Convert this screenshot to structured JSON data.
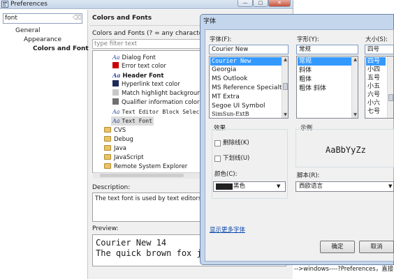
{
  "preferences": {
    "title": "Preferences",
    "filter_value": "font",
    "tree": [
      "General",
      "Appearance",
      "Colors and Fonts"
    ],
    "section_title": "Colors and Fonts",
    "colors_desc": "Colors and Fonts (? = any character, * =",
    "type_filter_placeholder": "type filter text",
    "items": [
      {
        "label": "Dialog Font",
        "icon": "font-aa-icon"
      },
      {
        "label": "Error text color",
        "icon": "red-square-icon"
      },
      {
        "label": "Header Font",
        "icon": "font-aa-icon"
      },
      {
        "label": "Hyperlink text color",
        "icon": "navy-square-icon"
      },
      {
        "label": "Match highlight background",
        "icon": "grey-square-icon"
      },
      {
        "label": "Qualifier information color",
        "icon": "darkgrey-square-icon"
      },
      {
        "label": "Text Editor Block Select",
        "icon": "font-aa-icon"
      },
      {
        "label": "Text Font",
        "icon": "font-aa-icon"
      },
      {
        "label": "CVS",
        "icon": "folder-icon"
      },
      {
        "label": "Debug",
        "icon": "folder-icon"
      },
      {
        "label": "Java",
        "icon": "folder-icon"
      },
      {
        "label": "JavaScript",
        "icon": "folder-icon"
      },
      {
        "label": "Remote System Explorer",
        "icon": "folder-icon"
      }
    ],
    "description_label": "Description:",
    "description_text": "The text font is used by text editors.",
    "preview_label": "Preview:",
    "preview_lines": [
      "Courier New 14",
      "The quick brown fox j"
    ],
    "colors": {
      "error": "#cc0000",
      "hyperlink": "#1f2a5a",
      "highlight": "#c8c8c8",
      "qualifier": "#707070"
    }
  },
  "font_dialog": {
    "title": "字体",
    "font_label": "字体(F):",
    "font_value": "Courier New",
    "font_list": [
      "Courier New",
      "Georgia",
      "MS Outlook",
      "MS Reference Specialt",
      "MT Extra",
      "Segoe UI Symbol",
      "SimSun-ExtB"
    ],
    "style_label": "字形(Y):",
    "style_value": "常规",
    "style_list": [
      "常规",
      "斜体",
      "粗体",
      "粗体 斜体"
    ],
    "size_label": "大小(S):",
    "size_value": "四号",
    "size_list": [
      "四号",
      "小四",
      "五号",
      "小五",
      "六号",
      "小六",
      "七号"
    ],
    "effects_label": "效果",
    "strikeout_label": "删除线(K)",
    "underline_label": "下划线(U)",
    "color_label": "颜色(C):",
    "color_value": "黑色",
    "sample_label": "示例",
    "sample_text": "AaBbYyZz",
    "script_label": "脚本(R):",
    "script_value": "西欧语言",
    "more_fonts": "显示更多字体",
    "ok": "确定",
    "cancel": "取消"
  },
  "background_text": "-->windows----?Preferences，直接"
}
